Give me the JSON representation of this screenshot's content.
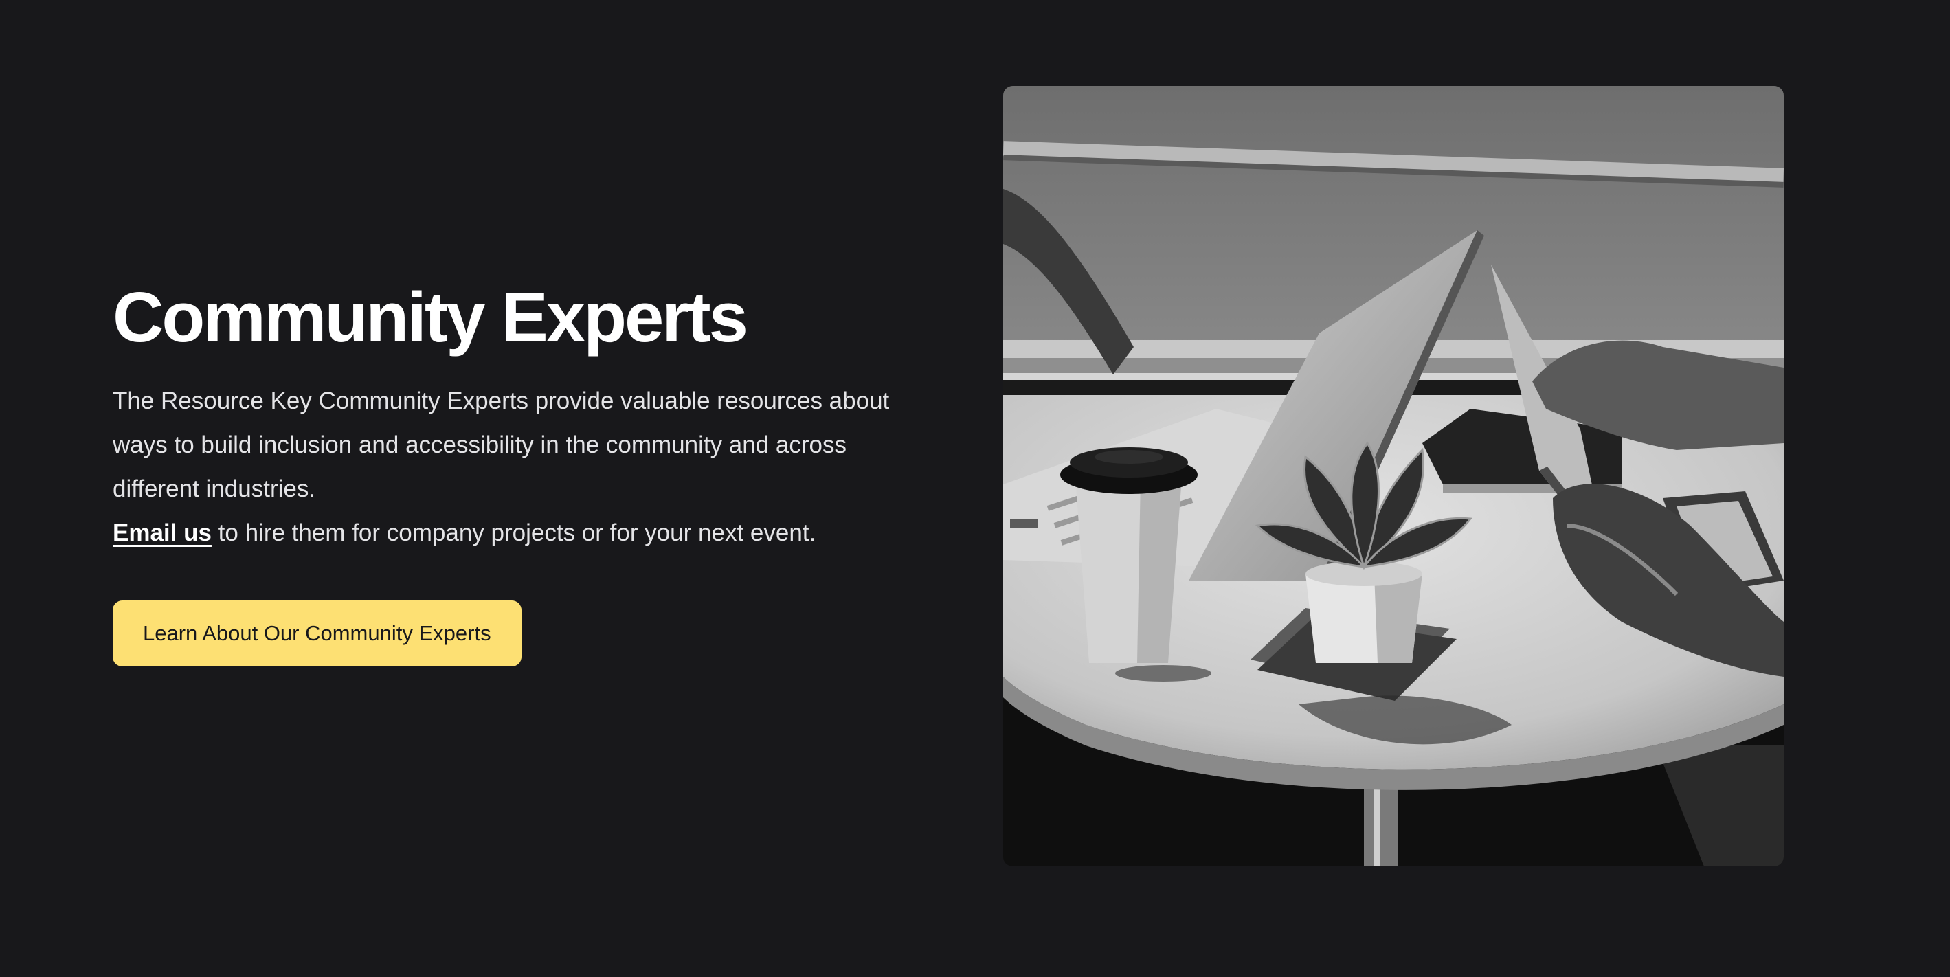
{
  "section": {
    "title": "Community Experts",
    "description": "The Resource Key Community Experts provide valuable resources about ways to build inclusion and accessibility in the community and across different industries.",
    "email_link_label": "Email us",
    "email_followup": " to hire them for company projects or for your next event.",
    "cta_label": "Learn About Our Community Experts"
  },
  "theme": {
    "background": "#18181b",
    "accent": "#fde073",
    "heading_color": "#ffffff",
    "text_color": "#e4e4e7"
  },
  "image": {
    "subject": "black-and-white photo of a table with laptops, a coffee cup and a potted plant"
  }
}
